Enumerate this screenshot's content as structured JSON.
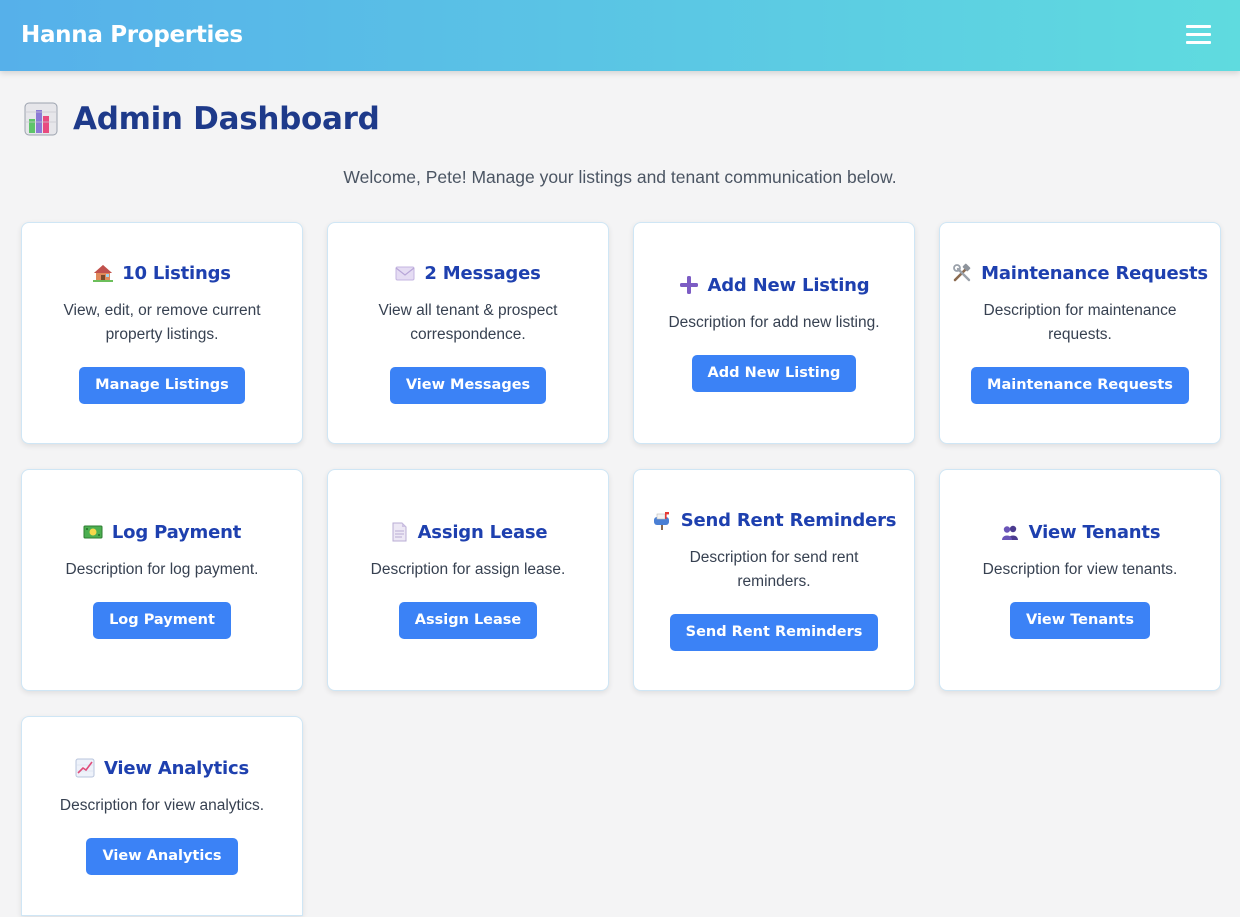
{
  "navbar": {
    "brand": "Hanna Properties",
    "menu_icon": "hamburger-menu-icon",
    "gradient": [
      "#56b0ea",
      "#5fdbdf"
    ]
  },
  "header": {
    "title_icon": "bar-chart-icon",
    "title": "Admin Dashboard",
    "welcome": "Welcome, Pete! Manage your listings and tenant communication below."
  },
  "colors": {
    "title": "#1e3a8a",
    "card_title": "#1e40af",
    "button": "#3b82f6",
    "background": "#f4f4f5"
  },
  "cards": [
    {
      "icon": "house-icon",
      "title": "10 Listings",
      "description": "View, edit, or remove current property listings.",
      "button": "Manage Listings"
    },
    {
      "icon": "envelope-icon",
      "title": "2 Messages",
      "description": "View all tenant & prospect correspondence.",
      "button": "View Messages"
    },
    {
      "icon": "plus-icon",
      "title": "Add New Listing",
      "description": "Description for add new listing.",
      "button": "Add New Listing"
    },
    {
      "icon": "tools-icon",
      "title": "Maintenance Requests",
      "description": "Description for maintenance requests.",
      "button": "Maintenance Requests"
    },
    {
      "icon": "cash-icon",
      "title": "Log Payment",
      "description": "Description for log payment.",
      "button": "Log Payment"
    },
    {
      "icon": "document-icon",
      "title": "Assign Lease",
      "description": "Description for assign lease.",
      "button": "Assign Lease"
    },
    {
      "icon": "mailbox-icon",
      "title": "Send Rent Reminders",
      "description": "Description for send rent reminders.",
      "button": "Send Rent Reminders"
    },
    {
      "icon": "people-icon",
      "title": "View Tenants",
      "description": "Description for view tenants.",
      "button": "View Tenants"
    },
    {
      "icon": "trend-chart-icon",
      "title": "View Analytics",
      "description": "Description for view analytics.",
      "button": "View Analytics"
    }
  ]
}
